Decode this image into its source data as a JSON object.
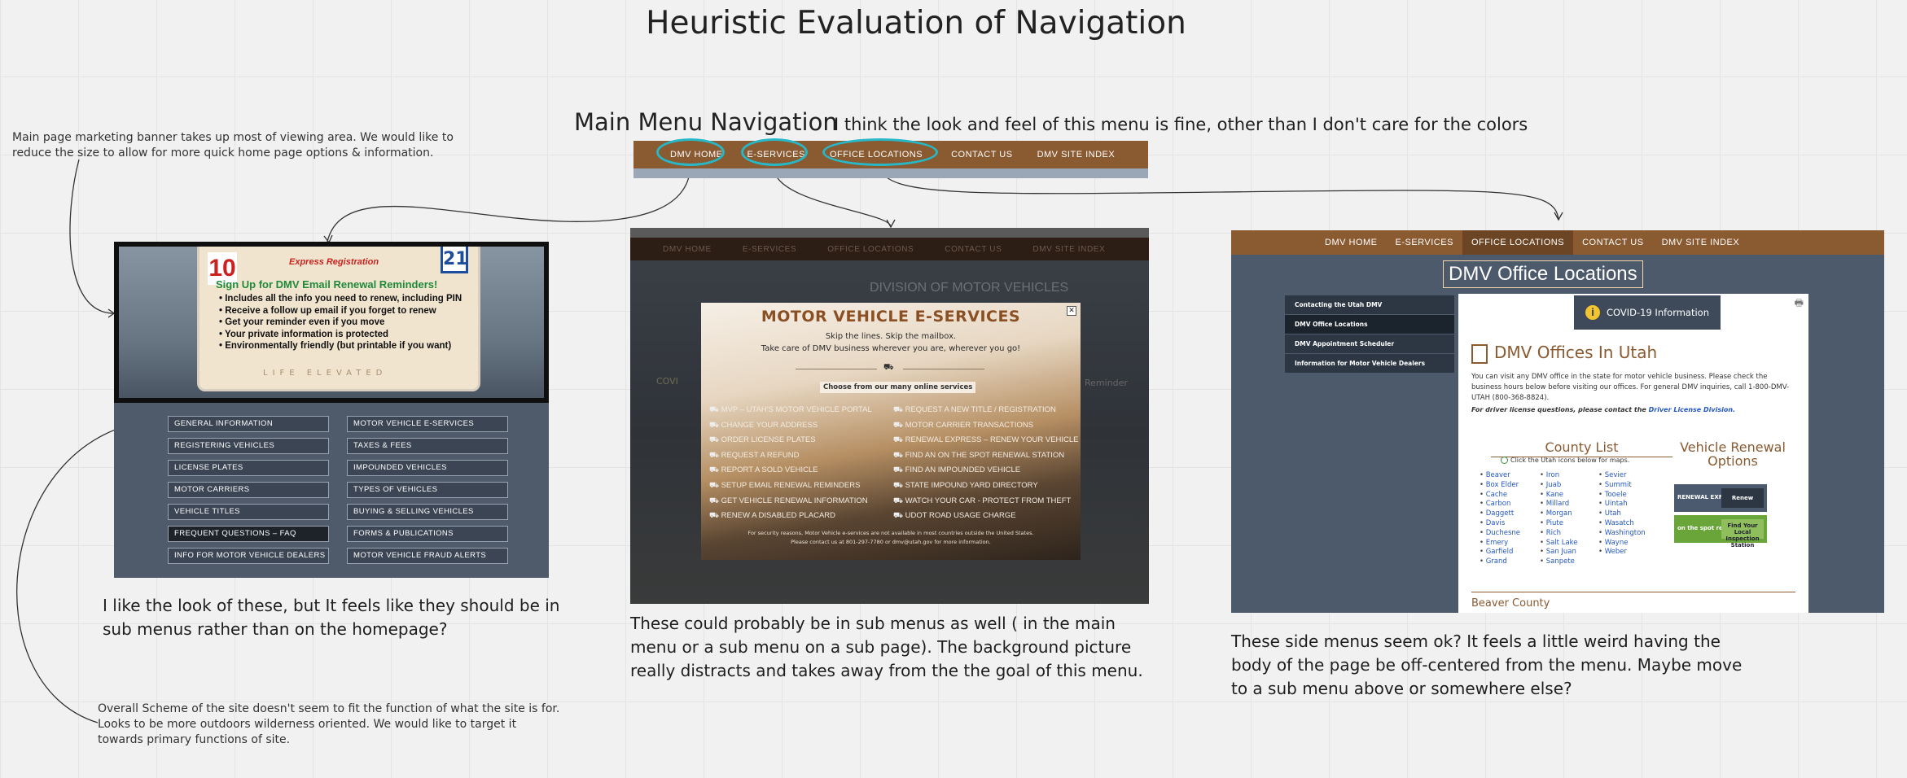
{
  "title": "Heuristic Evaluation of Navigation",
  "notes": {
    "marketing_banner": "Main page marketing banner takes up most of viewing area.  We would like to reduce the size to allow for more quick home page options & information.",
    "overall_scheme": "Overall Scheme of the site doesn't seem to fit the function of what the site is for.  Looks to be more outdoors wilderness oriented.  We would like to target it towards primary functions of site."
  },
  "main_menu": {
    "heading": "Main Menu Navigation",
    "comment": "I think the look and feel of this menu is fine, other than I don't care for the colors",
    "items": [
      "DMV HOME",
      "E-SERVICES",
      "OFFICE LOCATIONS",
      "CONTACT US",
      "DMV SITE INDEX"
    ]
  },
  "home_screenshot": {
    "banner": {
      "plate_left": "10",
      "plate_right": "21",
      "express": "Express Registration",
      "signup": "Sign Up for DMV Email Renewal Reminders!",
      "bullets": [
        "Includes all the info you need to renew, including PIN",
        "Receive a follow up email if you forget to renew",
        "Get your reminder even if you move",
        "Your private information is protected",
        "Environmentally friendly (but printable if you want)"
      ],
      "tagline": "LIFE ELEVATED"
    },
    "buttons": [
      "GENERAL INFORMATION",
      "MOTOR VEHICLE E-SERVICES",
      "REGISTERING VEHICLES",
      "TAXES & FEES",
      "LICENSE PLATES",
      "IMPOUNDED VEHICLES",
      "MOTOR CARRIERS",
      "TYPES OF VEHICLES",
      "VEHICLE TITLES",
      "BUYING & SELLING VEHICLES",
      "FREQUENT QUESTIONS – FAQ",
      "FORMS & PUBLICATIONS",
      "INFO FOR MOTOR VEHICLE DEALERS",
      "MOTOR VEHICLE FRAUD ALERTS"
    ],
    "comment": "I like the look of these, but It feels like they should be in sub menus rather than on the homepage?"
  },
  "eservices_screenshot": {
    "nav": [
      "DMV HOME",
      "E-SERVICES",
      "OFFICE LOCATIONS",
      "CONTACT US",
      "DMV SITE INDEX"
    ],
    "bg_heading": "DIVISION OF MOTOR VEHICLES",
    "bg_covid": "COVI",
    "bg_reminder": "Reminder",
    "modal": {
      "title": "MOTOR VEHICLE E-SERVICES",
      "sub1": "Skip the lines. Skip the mailbox.",
      "sub2": "Take care of DMV business wherever you are, wherever you go!",
      "choose": "Choose from our many online services",
      "close": "✕",
      "left": [
        "MVP – UTAH'S MOTOR VEHICLE PORTAL",
        "CHANGE YOUR ADDRESS",
        "ORDER LICENSE PLATES",
        "REQUEST A REFUND",
        "REPORT A SOLD VEHICLE",
        "SETUP EMAIL RENEWAL REMINDERS",
        "GET VEHICLE RENEWAL INFORMATION",
        "RENEW A DISABLED PLACARD"
      ],
      "right": [
        "REQUEST A NEW TITLE / REGISTRATION",
        "MOTOR CARRIER TRANSACTIONS",
        "RENEWAL EXPRESS – RENEW YOUR VEHICLE",
        "FIND AN ON THE SPOT RENEWAL STATION",
        "FIND AN IMPOUNDED VEHICLE",
        "STATE IMPOUND YARD DIRECTORY",
        "WATCH YOUR CAR - PROTECT FROM THEFT",
        "UDOT ROAD USAGE CHARGE"
      ],
      "fine1": "For security reasons, Motor Vehicle e-services are not available in most countries outside the United States.",
      "fine2": "Please contact us at 801-297-7780 or dmv@utah.gov for more information."
    },
    "comment": "These could probably be in sub menus as well ( in the main menu or a sub menu on a sub page). The background picture really distracts and takes away from the the goal of this menu."
  },
  "offices_screenshot": {
    "nav": [
      "DMV HOME",
      "E-SERVICES",
      "OFFICE LOCATIONS",
      "CONTACT US",
      "DMV SITE INDEX"
    ],
    "title": "DMV Office Locations",
    "side": [
      "Contacting the Utah DMV",
      "DMV Office Locations",
      "DMV Appointment Scheduler",
      "Information for Motor Vehicle Dealers"
    ],
    "covid": "COVID-19 Information",
    "offices_heading": "DMV Offices In Utah",
    "intro": "You can visit any DMV office in the state for motor vehicle business. Please check the business hours below before visiting our offices. For general DMV inquiries, call 1-800-DMV-UTAH (800-368-8824).",
    "license_q": "For driver license questions, please contact the ",
    "license_link": "Driver License Division.",
    "county_list": "County List",
    "county_hint": "Click the Utah icons below for maps.",
    "counties_1": [
      "Beaver",
      "Box Elder",
      "Cache",
      "Carbon",
      "Daggett",
      "Davis",
      "Duchesne",
      "Emery",
      "Garfield",
      "Grand"
    ],
    "counties_2": [
      "Iron",
      "Juab",
      "Kane",
      "Millard",
      "Morgan",
      "Piute",
      "Rich",
      "Salt Lake",
      "San Juan",
      "Sanpete"
    ],
    "counties_3": [
      "Sevier",
      "Summit",
      "Tooele",
      "Uintah",
      "Utah",
      "Wasatch",
      "Washington",
      "Wayne",
      "Weber"
    ],
    "renewal": "Vehicle Renewal Options",
    "renew1_label": "RENEWAL EXPRESS",
    "renew1_btn": "Renew Online",
    "renew2_label": "on the spot renewal",
    "renew2_btn": "Find Your Local Inspection Station",
    "beaver": "Beaver County",
    "comment": "These side menus seem ok? It feels a little weird having the body of the page be off-centered from the menu. Maybe move to a sub menu above or somewhere else?"
  },
  "colors": {
    "brown": "#8a5a31",
    "highlight": "#27b8c7",
    "slate": "#4d5a6c"
  }
}
